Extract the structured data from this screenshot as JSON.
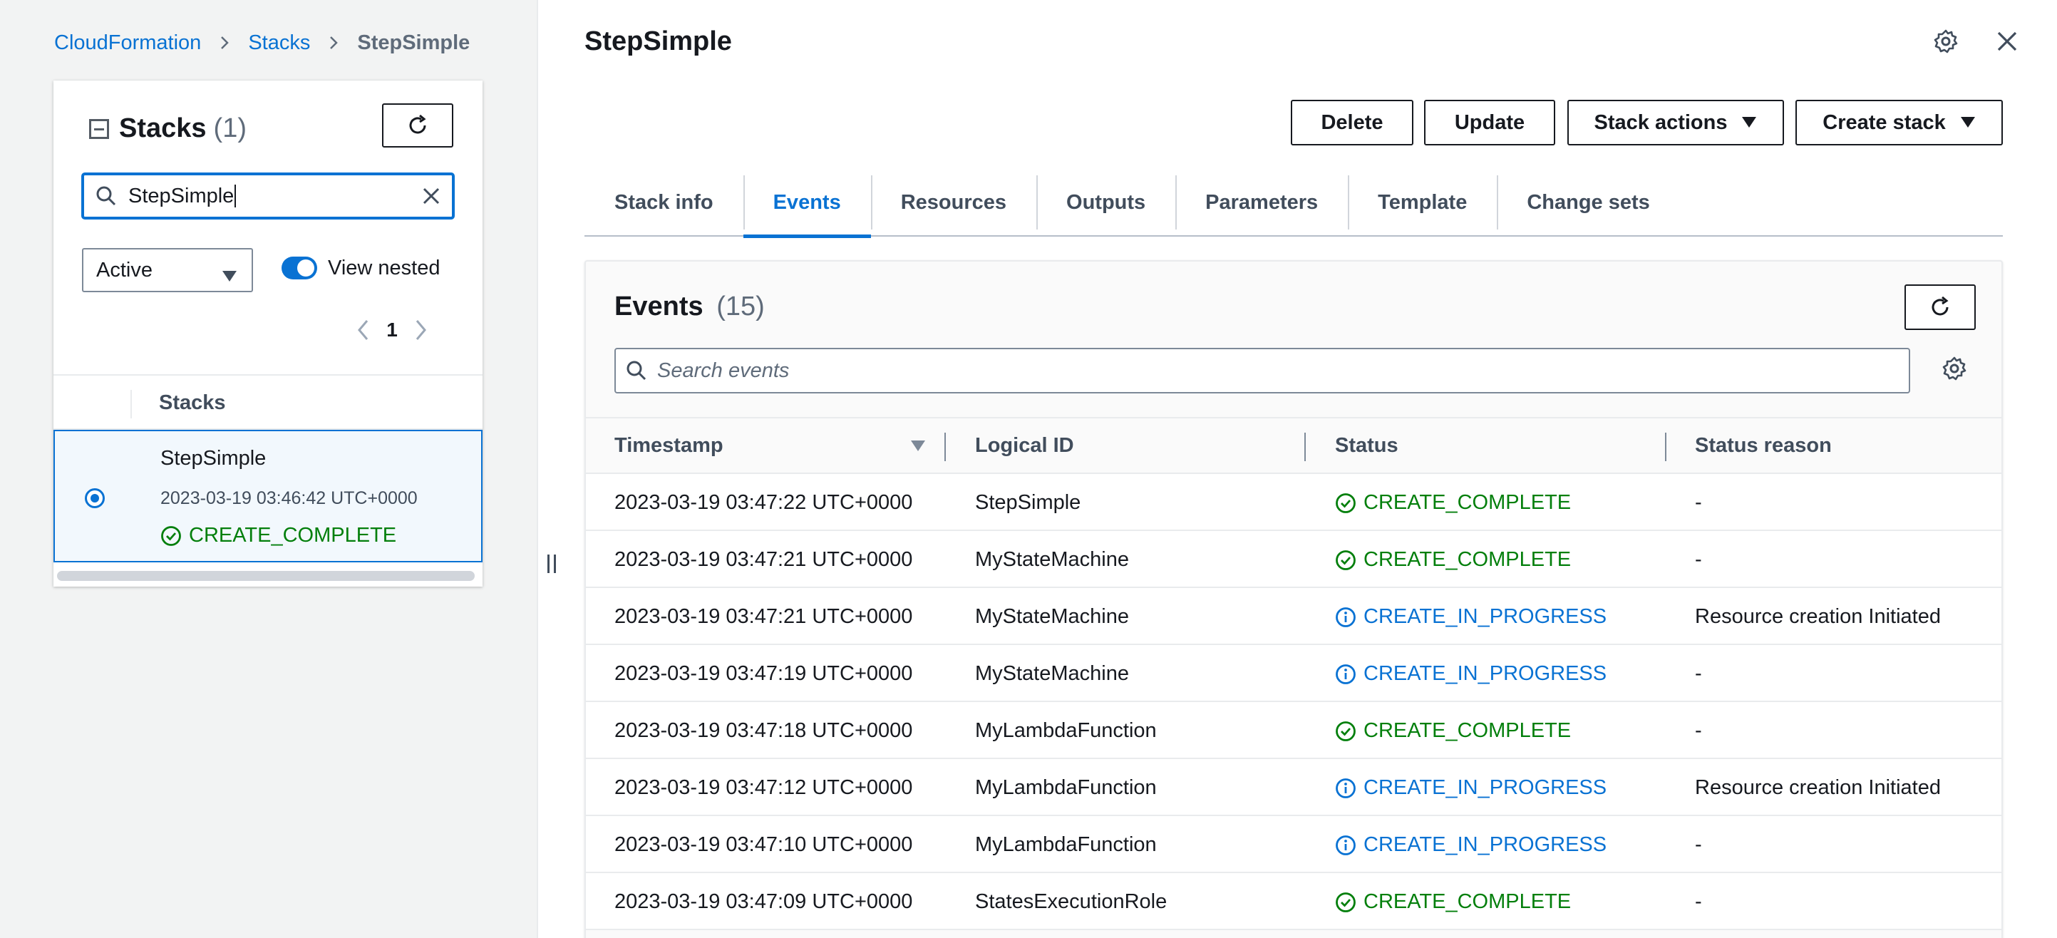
{
  "breadcrumb": {
    "items": [
      "CloudFormation",
      "Stacks"
    ],
    "current": "StepSimple"
  },
  "left": {
    "title": "Stacks",
    "count": "(1)",
    "search_value": "StepSimple",
    "filter_selected": "Active",
    "toggle_label": "View nested",
    "toggle_on": true,
    "page_number": "1",
    "column_header": "Stacks",
    "row": {
      "name": "StepSimple",
      "timestamp": "2023-03-19 03:46:42 UTC+0000",
      "status": "CREATE_COMPLETE"
    }
  },
  "main": {
    "title": "StepSimple",
    "actions": {
      "delete": "Delete",
      "update": "Update",
      "stack_actions": "Stack actions",
      "create_stack": "Create stack"
    },
    "tabs": [
      "Stack info",
      "Events",
      "Resources",
      "Outputs",
      "Parameters",
      "Template",
      "Change sets"
    ],
    "active_tab": "Events"
  },
  "events": {
    "title": "Events",
    "count": "(15)",
    "search_placeholder": "Search events",
    "columns": [
      "Timestamp",
      "Logical ID",
      "Status",
      "Status reason"
    ],
    "rows": [
      {
        "timestamp": "2023-03-19 03:47:22 UTC+0000",
        "logical_id": "StepSimple",
        "status": "CREATE_COMPLETE",
        "kind": "ok",
        "reason": "-"
      },
      {
        "timestamp": "2023-03-19 03:47:21 UTC+0000",
        "logical_id": "MyStateMachine",
        "status": "CREATE_COMPLETE",
        "kind": "ok",
        "reason": "-"
      },
      {
        "timestamp": "2023-03-19 03:47:21 UTC+0000",
        "logical_id": "MyStateMachine",
        "status": "CREATE_IN_PROGRESS",
        "kind": "prog",
        "reason": "Resource creation Initiated"
      },
      {
        "timestamp": "2023-03-19 03:47:19 UTC+0000",
        "logical_id": "MyStateMachine",
        "status": "CREATE_IN_PROGRESS",
        "kind": "prog",
        "reason": "-"
      },
      {
        "timestamp": "2023-03-19 03:47:18 UTC+0000",
        "logical_id": "MyLambdaFunction",
        "status": "CREATE_COMPLETE",
        "kind": "ok",
        "reason": "-"
      },
      {
        "timestamp": "2023-03-19 03:47:12 UTC+0000",
        "logical_id": "MyLambdaFunction",
        "status": "CREATE_IN_PROGRESS",
        "kind": "prog",
        "reason": "Resource creation Initiated"
      },
      {
        "timestamp": "2023-03-19 03:47:10 UTC+0000",
        "logical_id": "MyLambdaFunction",
        "status": "CREATE_IN_PROGRESS",
        "kind": "prog",
        "reason": "-"
      },
      {
        "timestamp": "2023-03-19 03:47:09 UTC+0000",
        "logical_id": "StatesExecutionRole",
        "status": "CREATE_COMPLETE",
        "kind": "ok",
        "reason": "-"
      }
    ]
  },
  "colors": {
    "link": "#0972d3",
    "success": "#037f0c",
    "in_progress": "#0972d3",
    "panel_bg": "#f2f3f3"
  }
}
